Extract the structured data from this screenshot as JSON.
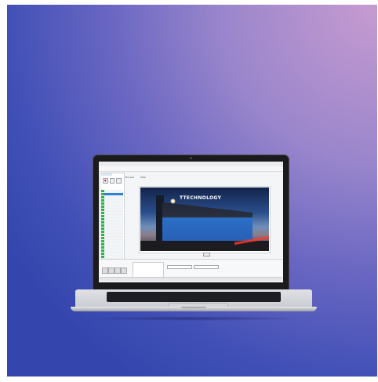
{
  "background": {
    "gradient_colors": [
      "#c79bd0",
      "#6a67c2",
      "#3446ad"
    ]
  },
  "app": {
    "window_title": "",
    "brand_mini": "",
    "menu": [
      "File",
      "Image",
      "Process",
      "Help"
    ]
  },
  "photo": {
    "building_sign": "TTECHNOLOGY"
  },
  "bottom": {
    "left_label": "",
    "field_label": ""
  }
}
